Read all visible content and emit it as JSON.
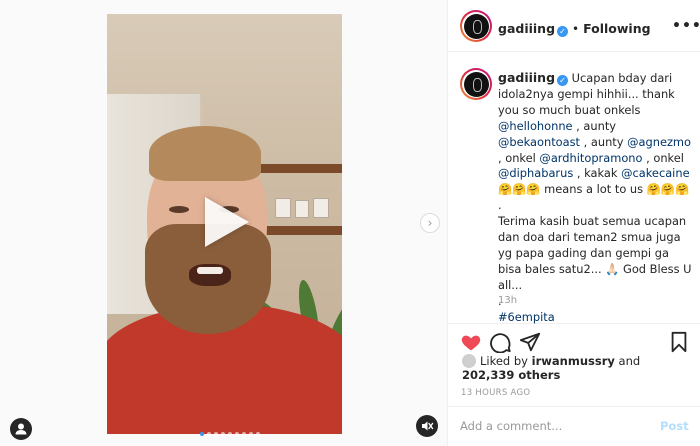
{
  "post": {
    "username": "gadiiing",
    "follow_separator": "•",
    "follow_state": "Following",
    "more_label": "•••",
    "verified_mark": "✓"
  },
  "caption": {
    "username": "gadiiing",
    "segments": [
      {
        "t": "text",
        "v": "Ucapan bday dari idola2nya gempi hihhii... thank you so much buat onkels "
      },
      {
        "t": "mention",
        "v": "@hellohonne"
      },
      {
        "t": "text",
        "v": " , aunty "
      },
      {
        "t": "mention",
        "v": "@bekaontoast"
      },
      {
        "t": "text",
        "v": " , aunty "
      },
      {
        "t": "mention",
        "v": "@agnezmo"
      },
      {
        "t": "text",
        "v": " , onkel "
      },
      {
        "t": "mention",
        "v": "@ardhitopramono"
      },
      {
        "t": "text",
        "v": " , onkel "
      },
      {
        "t": "mention",
        "v": "@diphabarus"
      },
      {
        "t": "text",
        "v": " , kakak "
      },
      {
        "t": "mention",
        "v": "@cakecaine"
      },
      {
        "t": "text",
        "v": " 🤗🤗🤗 means a lot to us 🤗🤗🤗"
      },
      {
        "t": "br"
      },
      {
        "t": "text",
        "v": "."
      },
      {
        "t": "br"
      },
      {
        "t": "text",
        "v": "Terima kasih buat semua ucapan dan doa dari teman2 smua juga yg papa gading dan gempi ga bisa bales satu2... 🙏🏻 God Bless U all..."
      },
      {
        "t": "br"
      },
      {
        "t": "text",
        "v": "."
      },
      {
        "t": "br"
      },
      {
        "t": "mention",
        "v": "#6empita"
      }
    ],
    "time_ago": "13h"
  },
  "likes": {
    "prefix": "Liked by ",
    "liker": "irwanmussry",
    "joiner": " and",
    "others": "202,339 others"
  },
  "posted_time": "13 HOURS AGO",
  "comment": {
    "placeholder": "Add a comment...",
    "post_label": "Post"
  },
  "media": {
    "next_label": "›"
  },
  "icons": {
    "like": "heart-filled-icon",
    "comment": "comment-bubble-icon",
    "share": "paper-plane-icon",
    "save": "bookmark-icon",
    "user_tag": "user-tag-icon",
    "mute": "speaker-muted-icon",
    "play": "play-icon",
    "next": "chevron-right-icon"
  },
  "colors": {
    "like": "#ed4956",
    "mention": "#003569",
    "verified": "#3897f0",
    "post_disabled": "#b2dffc",
    "muted_text": "#999999"
  }
}
